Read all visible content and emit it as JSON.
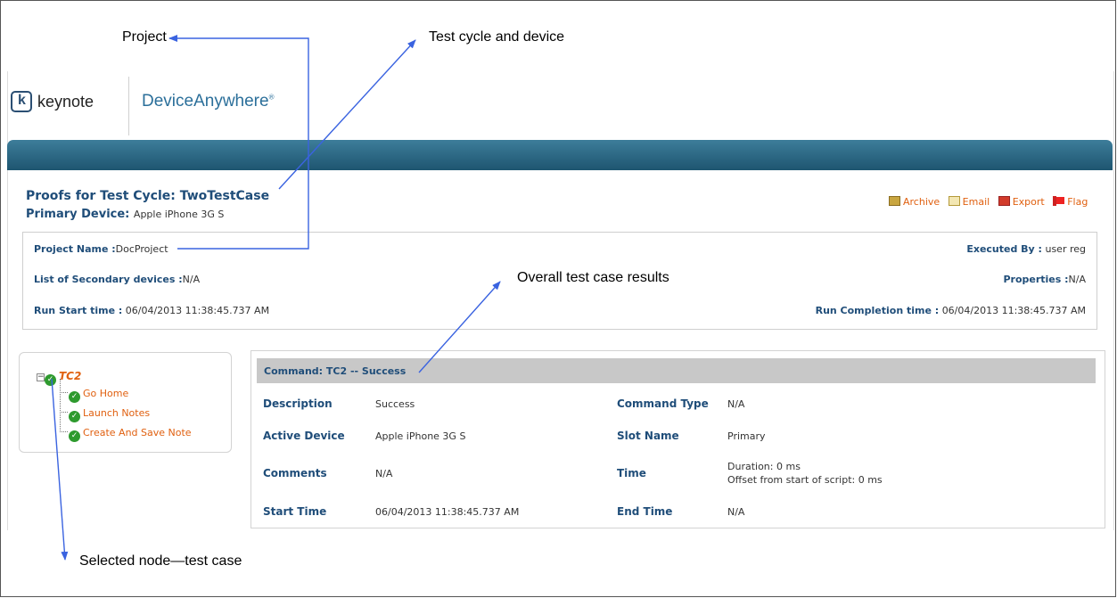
{
  "annotations": {
    "project": "Project",
    "test_cycle": "Test cycle and device",
    "overall": "Overall test case results",
    "selected": "Selected node—test case"
  },
  "logo": {
    "keynote": "keynote",
    "device_anywhere": "DeviceAnywhere"
  },
  "header": {
    "proofs_title": "Proofs for Test Cycle: TwoTestCase",
    "primary_label": "Primary Device:",
    "primary_value": "Apple iPhone 3G S"
  },
  "actions": {
    "archive": "Archive",
    "email": "Email",
    "export": "Export",
    "flag": "Flag"
  },
  "info": {
    "project_label": "Project Name :",
    "project_value": "DocProject",
    "executed_label": "Executed By :",
    "executed_value": "user reg",
    "secondary_label": "List of Secondary devices :",
    "secondary_value": "N/A",
    "properties_label": "Properties :",
    "properties_value": "N/A",
    "start_label": "Run Start time :",
    "start_value": "06/04/2013 11:38:45.737 AM",
    "completion_label": "Run Completion time :",
    "completion_value": "06/04/2013 11:38:45.737 AM"
  },
  "tree": {
    "root": "TC2",
    "items": [
      "Go Home",
      "Launch Notes",
      "Create And Save Note"
    ]
  },
  "command": {
    "header": "Command: TC2 -- Success",
    "description_label": "Description",
    "description_value": "Success",
    "command_type_label": "Command Type",
    "command_type_value": "N/A",
    "active_device_label": "Active Device",
    "active_device_value": "Apple iPhone 3G S",
    "slot_name_label": "Slot Name",
    "slot_name_value": "Primary",
    "comments_label": "Comments",
    "comments_value": "N/A",
    "time_label": "Time",
    "time_duration": "Duration: 0 ms",
    "time_offset": "Offset from start of script: 0 ms",
    "start_time_label": "Start Time",
    "start_time_value": "06/04/2013 11:38:45.737 AM",
    "end_time_label": "End Time",
    "end_time_value": "N/A"
  },
  "colors": {
    "accent": "#e06010",
    "label_blue": "#1f4d79",
    "banner": "#2a6783",
    "arrow": "#3a63e0"
  },
  "icons": [
    "archive-icon",
    "email-icon",
    "export-pdf-icon",
    "flag-icon",
    "check-icon",
    "collapse-icon"
  ]
}
